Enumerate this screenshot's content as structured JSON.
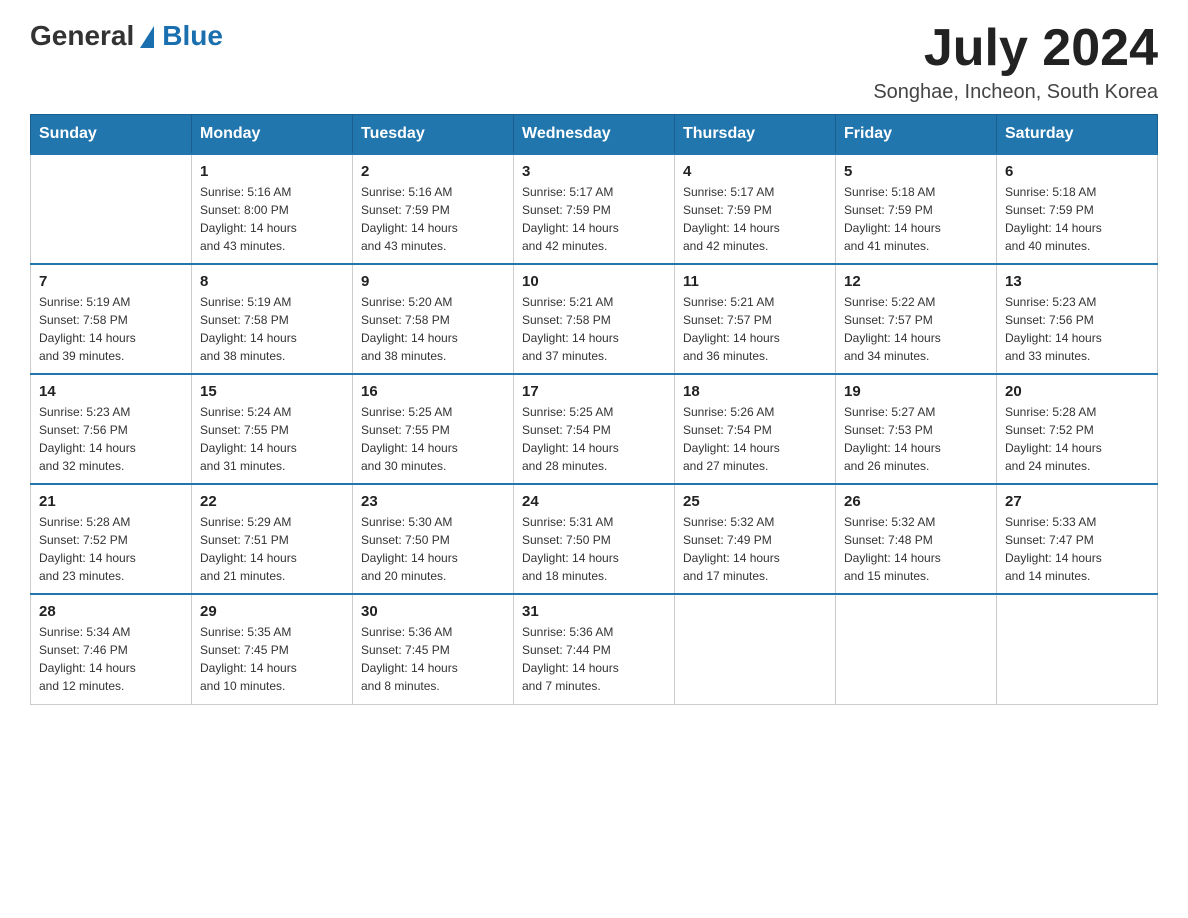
{
  "header": {
    "logo_general": "General",
    "logo_blue": "Blue",
    "month_year": "July 2024",
    "location": "Songhae, Incheon, South Korea"
  },
  "days_of_week": [
    "Sunday",
    "Monday",
    "Tuesday",
    "Wednesday",
    "Thursday",
    "Friday",
    "Saturday"
  ],
  "weeks": [
    [
      {
        "day": "",
        "info": ""
      },
      {
        "day": "1",
        "info": "Sunrise: 5:16 AM\nSunset: 8:00 PM\nDaylight: 14 hours\nand 43 minutes."
      },
      {
        "day": "2",
        "info": "Sunrise: 5:16 AM\nSunset: 7:59 PM\nDaylight: 14 hours\nand 43 minutes."
      },
      {
        "day": "3",
        "info": "Sunrise: 5:17 AM\nSunset: 7:59 PM\nDaylight: 14 hours\nand 42 minutes."
      },
      {
        "day": "4",
        "info": "Sunrise: 5:17 AM\nSunset: 7:59 PM\nDaylight: 14 hours\nand 42 minutes."
      },
      {
        "day": "5",
        "info": "Sunrise: 5:18 AM\nSunset: 7:59 PM\nDaylight: 14 hours\nand 41 minutes."
      },
      {
        "day": "6",
        "info": "Sunrise: 5:18 AM\nSunset: 7:59 PM\nDaylight: 14 hours\nand 40 minutes."
      }
    ],
    [
      {
        "day": "7",
        "info": "Sunrise: 5:19 AM\nSunset: 7:58 PM\nDaylight: 14 hours\nand 39 minutes."
      },
      {
        "day": "8",
        "info": "Sunrise: 5:19 AM\nSunset: 7:58 PM\nDaylight: 14 hours\nand 38 minutes."
      },
      {
        "day": "9",
        "info": "Sunrise: 5:20 AM\nSunset: 7:58 PM\nDaylight: 14 hours\nand 38 minutes."
      },
      {
        "day": "10",
        "info": "Sunrise: 5:21 AM\nSunset: 7:58 PM\nDaylight: 14 hours\nand 37 minutes."
      },
      {
        "day": "11",
        "info": "Sunrise: 5:21 AM\nSunset: 7:57 PM\nDaylight: 14 hours\nand 36 minutes."
      },
      {
        "day": "12",
        "info": "Sunrise: 5:22 AM\nSunset: 7:57 PM\nDaylight: 14 hours\nand 34 minutes."
      },
      {
        "day": "13",
        "info": "Sunrise: 5:23 AM\nSunset: 7:56 PM\nDaylight: 14 hours\nand 33 minutes."
      }
    ],
    [
      {
        "day": "14",
        "info": "Sunrise: 5:23 AM\nSunset: 7:56 PM\nDaylight: 14 hours\nand 32 minutes."
      },
      {
        "day": "15",
        "info": "Sunrise: 5:24 AM\nSunset: 7:55 PM\nDaylight: 14 hours\nand 31 minutes."
      },
      {
        "day": "16",
        "info": "Sunrise: 5:25 AM\nSunset: 7:55 PM\nDaylight: 14 hours\nand 30 minutes."
      },
      {
        "day": "17",
        "info": "Sunrise: 5:25 AM\nSunset: 7:54 PM\nDaylight: 14 hours\nand 28 minutes."
      },
      {
        "day": "18",
        "info": "Sunrise: 5:26 AM\nSunset: 7:54 PM\nDaylight: 14 hours\nand 27 minutes."
      },
      {
        "day": "19",
        "info": "Sunrise: 5:27 AM\nSunset: 7:53 PM\nDaylight: 14 hours\nand 26 minutes."
      },
      {
        "day": "20",
        "info": "Sunrise: 5:28 AM\nSunset: 7:52 PM\nDaylight: 14 hours\nand 24 minutes."
      }
    ],
    [
      {
        "day": "21",
        "info": "Sunrise: 5:28 AM\nSunset: 7:52 PM\nDaylight: 14 hours\nand 23 minutes."
      },
      {
        "day": "22",
        "info": "Sunrise: 5:29 AM\nSunset: 7:51 PM\nDaylight: 14 hours\nand 21 minutes."
      },
      {
        "day": "23",
        "info": "Sunrise: 5:30 AM\nSunset: 7:50 PM\nDaylight: 14 hours\nand 20 minutes."
      },
      {
        "day": "24",
        "info": "Sunrise: 5:31 AM\nSunset: 7:50 PM\nDaylight: 14 hours\nand 18 minutes."
      },
      {
        "day": "25",
        "info": "Sunrise: 5:32 AM\nSunset: 7:49 PM\nDaylight: 14 hours\nand 17 minutes."
      },
      {
        "day": "26",
        "info": "Sunrise: 5:32 AM\nSunset: 7:48 PM\nDaylight: 14 hours\nand 15 minutes."
      },
      {
        "day": "27",
        "info": "Sunrise: 5:33 AM\nSunset: 7:47 PM\nDaylight: 14 hours\nand 14 minutes."
      }
    ],
    [
      {
        "day": "28",
        "info": "Sunrise: 5:34 AM\nSunset: 7:46 PM\nDaylight: 14 hours\nand 12 minutes."
      },
      {
        "day": "29",
        "info": "Sunrise: 5:35 AM\nSunset: 7:45 PM\nDaylight: 14 hours\nand 10 minutes."
      },
      {
        "day": "30",
        "info": "Sunrise: 5:36 AM\nSunset: 7:45 PM\nDaylight: 14 hours\nand 8 minutes."
      },
      {
        "day": "31",
        "info": "Sunrise: 5:36 AM\nSunset: 7:44 PM\nDaylight: 14 hours\nand 7 minutes."
      },
      {
        "day": "",
        "info": ""
      },
      {
        "day": "",
        "info": ""
      },
      {
        "day": "",
        "info": ""
      }
    ]
  ]
}
